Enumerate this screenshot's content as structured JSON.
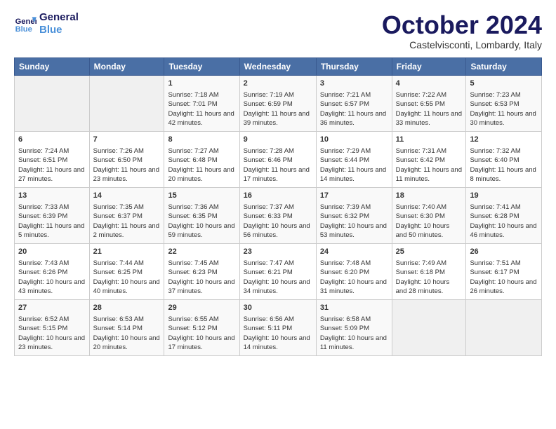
{
  "logo": {
    "line1": "General",
    "line2": "Blue"
  },
  "title": "October 2024",
  "subtitle": "Castelvisconti, Lombardy, Italy",
  "headers": [
    "Sunday",
    "Monday",
    "Tuesday",
    "Wednesday",
    "Thursday",
    "Friday",
    "Saturday"
  ],
  "weeks": [
    [
      {
        "day": "",
        "data": ""
      },
      {
        "day": "",
        "data": ""
      },
      {
        "day": "1",
        "data": "Sunrise: 7:18 AM\nSunset: 7:01 PM\nDaylight: 11 hours and 42 minutes."
      },
      {
        "day": "2",
        "data": "Sunrise: 7:19 AM\nSunset: 6:59 PM\nDaylight: 11 hours and 39 minutes."
      },
      {
        "day": "3",
        "data": "Sunrise: 7:21 AM\nSunset: 6:57 PM\nDaylight: 11 hours and 36 minutes."
      },
      {
        "day": "4",
        "data": "Sunrise: 7:22 AM\nSunset: 6:55 PM\nDaylight: 11 hours and 33 minutes."
      },
      {
        "day": "5",
        "data": "Sunrise: 7:23 AM\nSunset: 6:53 PM\nDaylight: 11 hours and 30 minutes."
      }
    ],
    [
      {
        "day": "6",
        "data": "Sunrise: 7:24 AM\nSunset: 6:51 PM\nDaylight: 11 hours and 27 minutes."
      },
      {
        "day": "7",
        "data": "Sunrise: 7:26 AM\nSunset: 6:50 PM\nDaylight: 11 hours and 23 minutes."
      },
      {
        "day": "8",
        "data": "Sunrise: 7:27 AM\nSunset: 6:48 PM\nDaylight: 11 hours and 20 minutes."
      },
      {
        "day": "9",
        "data": "Sunrise: 7:28 AM\nSunset: 6:46 PM\nDaylight: 11 hours and 17 minutes."
      },
      {
        "day": "10",
        "data": "Sunrise: 7:29 AM\nSunset: 6:44 PM\nDaylight: 11 hours and 14 minutes."
      },
      {
        "day": "11",
        "data": "Sunrise: 7:31 AM\nSunset: 6:42 PM\nDaylight: 11 hours and 11 minutes."
      },
      {
        "day": "12",
        "data": "Sunrise: 7:32 AM\nSunset: 6:40 PM\nDaylight: 11 hours and 8 minutes."
      }
    ],
    [
      {
        "day": "13",
        "data": "Sunrise: 7:33 AM\nSunset: 6:39 PM\nDaylight: 11 hours and 5 minutes."
      },
      {
        "day": "14",
        "data": "Sunrise: 7:35 AM\nSunset: 6:37 PM\nDaylight: 11 hours and 2 minutes."
      },
      {
        "day": "15",
        "data": "Sunrise: 7:36 AM\nSunset: 6:35 PM\nDaylight: 10 hours and 59 minutes."
      },
      {
        "day": "16",
        "data": "Sunrise: 7:37 AM\nSunset: 6:33 PM\nDaylight: 10 hours and 56 minutes."
      },
      {
        "day": "17",
        "data": "Sunrise: 7:39 AM\nSunset: 6:32 PM\nDaylight: 10 hours and 53 minutes."
      },
      {
        "day": "18",
        "data": "Sunrise: 7:40 AM\nSunset: 6:30 PM\nDaylight: 10 hours and 50 minutes."
      },
      {
        "day": "19",
        "data": "Sunrise: 7:41 AM\nSunset: 6:28 PM\nDaylight: 10 hours and 46 minutes."
      }
    ],
    [
      {
        "day": "20",
        "data": "Sunrise: 7:43 AM\nSunset: 6:26 PM\nDaylight: 10 hours and 43 minutes."
      },
      {
        "day": "21",
        "data": "Sunrise: 7:44 AM\nSunset: 6:25 PM\nDaylight: 10 hours and 40 minutes."
      },
      {
        "day": "22",
        "data": "Sunrise: 7:45 AM\nSunset: 6:23 PM\nDaylight: 10 hours and 37 minutes."
      },
      {
        "day": "23",
        "data": "Sunrise: 7:47 AM\nSunset: 6:21 PM\nDaylight: 10 hours and 34 minutes."
      },
      {
        "day": "24",
        "data": "Sunrise: 7:48 AM\nSunset: 6:20 PM\nDaylight: 10 hours and 31 minutes."
      },
      {
        "day": "25",
        "data": "Sunrise: 7:49 AM\nSunset: 6:18 PM\nDaylight: 10 hours and 28 minutes."
      },
      {
        "day": "26",
        "data": "Sunrise: 7:51 AM\nSunset: 6:17 PM\nDaylight: 10 hours and 26 minutes."
      }
    ],
    [
      {
        "day": "27",
        "data": "Sunrise: 6:52 AM\nSunset: 5:15 PM\nDaylight: 10 hours and 23 minutes."
      },
      {
        "day": "28",
        "data": "Sunrise: 6:53 AM\nSunset: 5:14 PM\nDaylight: 10 hours and 20 minutes."
      },
      {
        "day": "29",
        "data": "Sunrise: 6:55 AM\nSunset: 5:12 PM\nDaylight: 10 hours and 17 minutes."
      },
      {
        "day": "30",
        "data": "Sunrise: 6:56 AM\nSunset: 5:11 PM\nDaylight: 10 hours and 14 minutes."
      },
      {
        "day": "31",
        "data": "Sunrise: 6:58 AM\nSunset: 5:09 PM\nDaylight: 10 hours and 11 minutes."
      },
      {
        "day": "",
        "data": ""
      },
      {
        "day": "",
        "data": ""
      }
    ]
  ]
}
